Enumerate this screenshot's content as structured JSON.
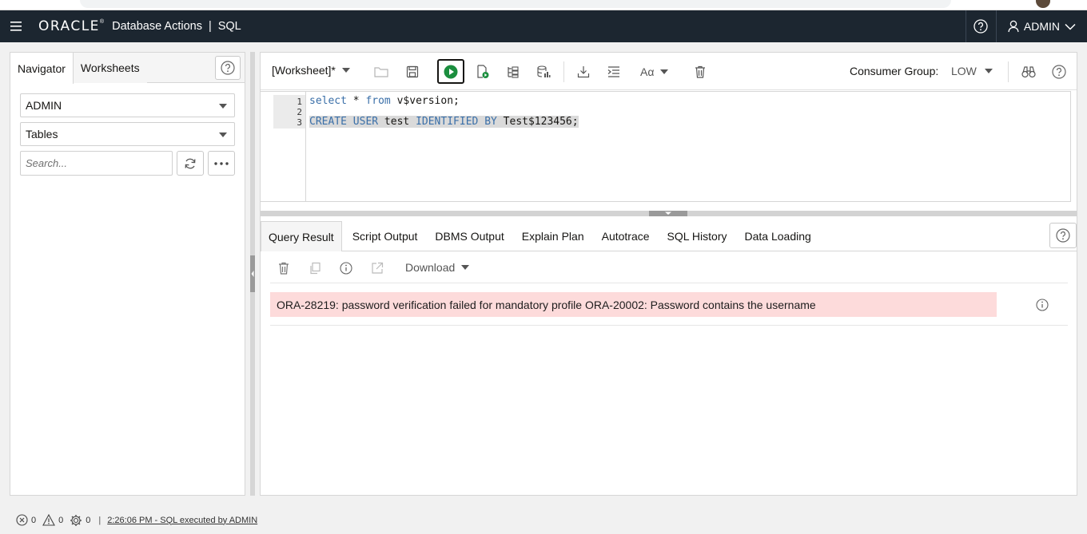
{
  "header": {
    "brand": "ORACLE",
    "brand_mark": "®",
    "product": "Database Actions",
    "separator": "|",
    "section": "SQL",
    "user": "ADMIN"
  },
  "navigator": {
    "tabs": [
      "Navigator",
      "Worksheets"
    ],
    "schema": "ADMIN",
    "object_type": "Tables",
    "search_placeholder": "Search..."
  },
  "worksheet": {
    "name": "[Worksheet]*",
    "consumer_group_label": "Consumer Group:",
    "consumer_group_value": "LOW",
    "font_label": "Aα"
  },
  "editor": {
    "line_numbers": [
      "1",
      "2",
      "3"
    ],
    "line1": {
      "kw1": "select",
      "star": " * ",
      "kw2": "from",
      "rest": " v$version;"
    },
    "line3": {
      "kw1": "CREATE",
      "kw2": "USER",
      "ident": " test ",
      "kw3": "IDENTIFIED",
      "kw4": "BY",
      "rest": " Test$123456;"
    }
  },
  "results": {
    "tabs": [
      "Query Result",
      "Script Output",
      "DBMS Output",
      "Explain Plan",
      "Autotrace",
      "SQL History",
      "Data Loading"
    ],
    "active_tab": "Query Result",
    "download_label": "Download",
    "error_message": "ORA-28219: password verification failed for mandatory profile ORA-20002: Password contains the username"
  },
  "status": {
    "errors": "0",
    "warnings": "0",
    "settings": "0",
    "separator": "|",
    "message": "2:26:06 PM - SQL executed by ADMIN"
  },
  "colors": {
    "header_bg": "#1c2630",
    "error_bg": "#fddbdb",
    "run_green": "#1b8e3e",
    "keyword": "#3a6fa8"
  }
}
